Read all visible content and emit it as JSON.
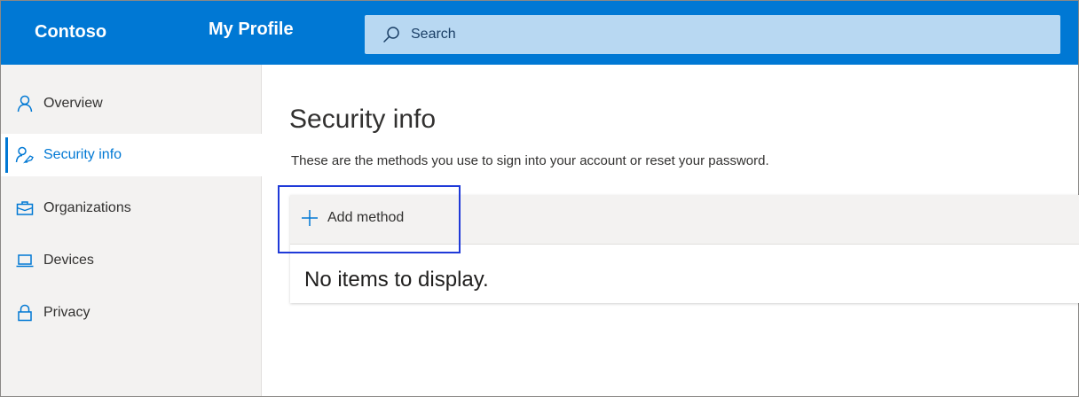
{
  "header": {
    "brand": "Contoso",
    "app_title": "My Profile",
    "search": {
      "placeholder": "Search"
    }
  },
  "sidebar": {
    "items": [
      {
        "label": "Overview",
        "icon": "person-icon",
        "active": false
      },
      {
        "label": "Security info",
        "icon": "person-key-icon",
        "active": true
      },
      {
        "label": "Organizations",
        "icon": "briefcase-icon",
        "active": false
      },
      {
        "label": "Devices",
        "icon": "laptop-icon",
        "active": false
      },
      {
        "label": "Privacy",
        "icon": "lock-icon",
        "active": false
      }
    ]
  },
  "main": {
    "title": "Security info",
    "subtitle": "These are the methods you use to sign into your account or reset your password.",
    "add_method_label": "Add method",
    "empty_message": "No items to display."
  },
  "colors": {
    "accent": "#0078d4",
    "search_bg": "#b8d8f2",
    "sidebar_bg": "#f3f2f1",
    "highlight_border": "#1f3ad8"
  }
}
